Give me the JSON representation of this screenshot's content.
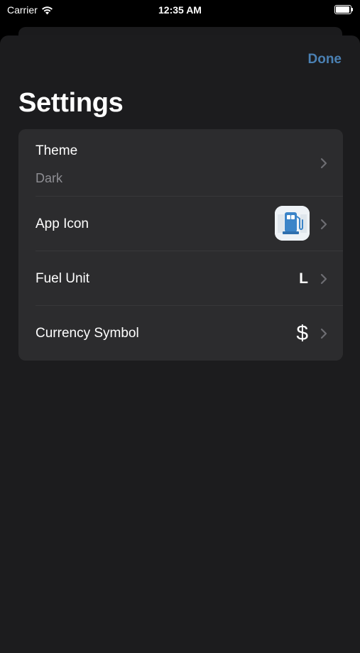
{
  "status_bar": {
    "carrier": "Carrier",
    "time": "12:35 AM"
  },
  "header": {
    "done_label": "Done",
    "title": "Settings"
  },
  "settings": {
    "theme": {
      "label": "Theme",
      "value": "Dark"
    },
    "app_icon": {
      "label": "App Icon",
      "icon_name": "fuel-pump-app-icon"
    },
    "fuel_unit": {
      "label": "Fuel Unit",
      "value": "L"
    },
    "currency_symbol": {
      "label": "Currency Symbol",
      "value": "$"
    }
  },
  "colors": {
    "accent": "#4a80b3",
    "sheet_background": "#1c1c1e",
    "group_background": "#2c2c2e",
    "secondary_text": "#8e8e93"
  }
}
